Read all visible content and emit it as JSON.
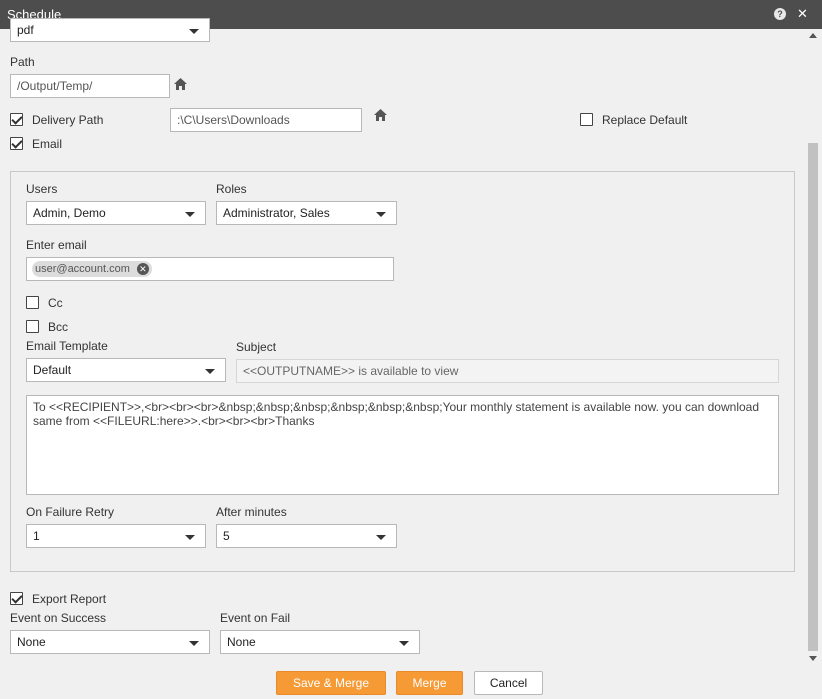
{
  "window": {
    "title": "Schedule"
  },
  "format": {
    "value": "pdf"
  },
  "path": {
    "label": "Path",
    "value": "/Output/Temp/"
  },
  "delivery": {
    "label": "Delivery Path",
    "value": ":\\C\\Users\\Downloads",
    "checked": true
  },
  "replace_default": {
    "label": "Replace Default",
    "checked": false
  },
  "email": {
    "label": "Email",
    "checked": true,
    "users_label": "Users",
    "users_value": "Admin, Demo",
    "roles_label": "Roles",
    "roles_value": "Administrator, Sales",
    "enter_email_label": "Enter email",
    "email_chip": "user@account.com",
    "cc_label": "Cc",
    "bcc_label": "Bcc",
    "template_label": "Email Template",
    "template_value": "Default",
    "subject_label": "Subject",
    "subject_value": "<<OUTPUTNAME>> is available to view",
    "body": "To <<RECIPIENT>>,<br><br><br>&nbsp;&nbsp;&nbsp;&nbsp;&nbsp;&nbsp;Your monthly statement is available now. you can download same from <<FILEURL:here>>.<br><br><br>Thanks",
    "retry_label": "On Failure Retry",
    "retry_value": "1",
    "after_label": "After minutes",
    "after_value": "5"
  },
  "export": {
    "label": "Export Report",
    "checked": true
  },
  "events": {
    "success_label": "Event on Success",
    "success_value": "None",
    "fail_label": "Event on Fail",
    "fail_value": "None"
  },
  "buttons": {
    "save_merge": "Save & Merge",
    "merge": "Merge",
    "cancel": "Cancel"
  },
  "colors": {
    "titlebar": "#4d4d4d",
    "accent": "#f59a34",
    "background": "#f1f0f0"
  }
}
